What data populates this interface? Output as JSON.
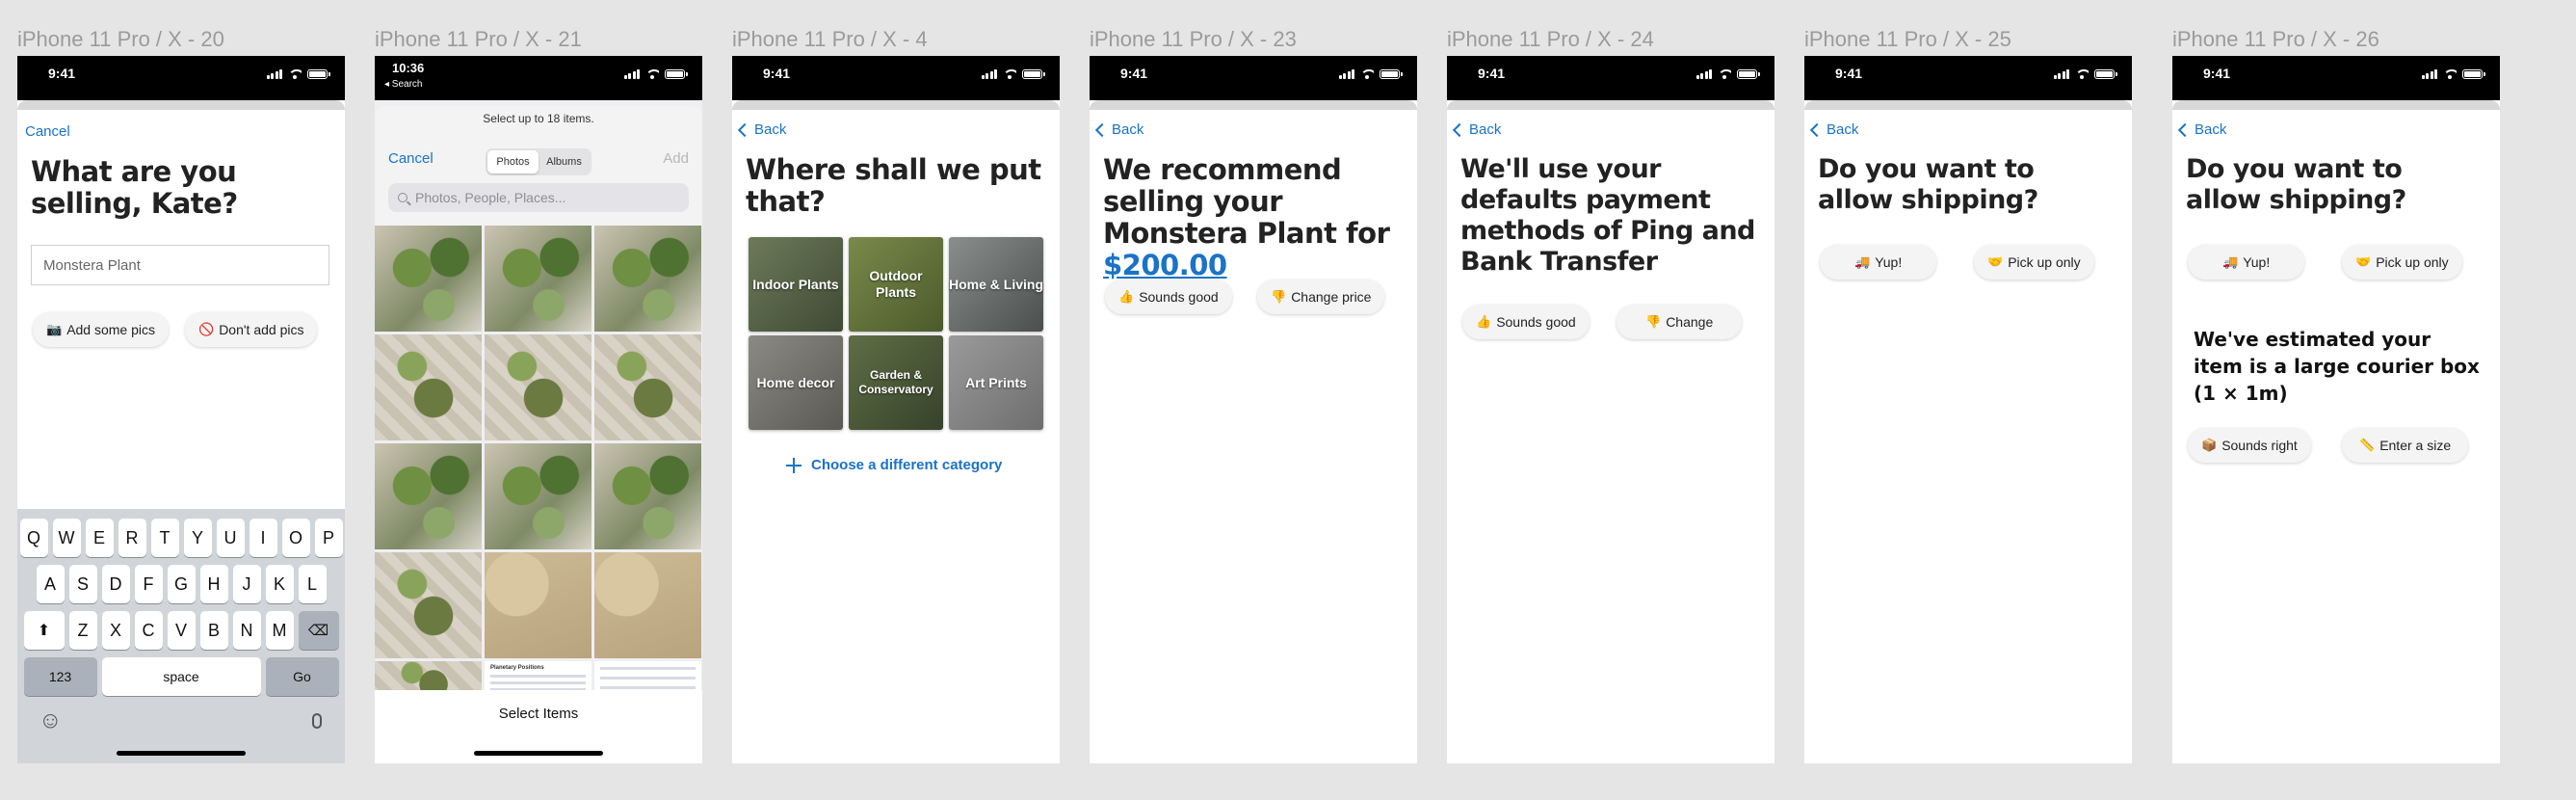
{
  "frames": [
    {
      "title": "iPhone 11 Pro / X - 20"
    },
    {
      "title": "iPhone 11 Pro / X - 21"
    },
    {
      "title": "iPhone 11 Pro / X - 4"
    },
    {
      "title": "iPhone 11 Pro / X - 23"
    },
    {
      "title": "iPhone 11 Pro / X - 24"
    },
    {
      "title": "iPhone 11 Pro / X - 25"
    },
    {
      "title": "iPhone 11 Pro / X - 26"
    }
  ],
  "status": {
    "time": "9:41",
    "time_alt": "10:36",
    "back_to_search": "◂ Search"
  },
  "screen20": {
    "cancel": "Cancel",
    "heading": "What are you selling, Kate?",
    "input_value": "Monstera Plant",
    "add_pics_emoji": "📷",
    "add_pics": "Add some pics",
    "no_pics_emoji": "🚫",
    "no_pics": "Don't add pics",
    "keyboard": {
      "row1": [
        "Q",
        "W",
        "E",
        "R",
        "T",
        "Y",
        "U",
        "I",
        "O",
        "P"
      ],
      "row2": [
        "A",
        "S",
        "D",
        "F",
        "G",
        "H",
        "J",
        "K",
        "L"
      ],
      "row3": [
        "Z",
        "X",
        "C",
        "V",
        "B",
        "N",
        "M"
      ],
      "numbers": "123",
      "space": "space",
      "go": "Go"
    }
  },
  "screen21": {
    "limit_text": "Select up to 18 items.",
    "cancel": "Cancel",
    "tab_photos": "Photos",
    "tab_albums": "Albums",
    "add": "Add",
    "search_placeholder": "Photos, People, Places...",
    "sheet_title": "Planetary Positions",
    "select_items": "Select Items"
  },
  "screen4": {
    "back": "Back",
    "heading": "Where shall we put that?",
    "categories": [
      "Indoor Plants",
      "Outdoor Plants",
      "Home & Living",
      "Home decor",
      "Garden & Conservatory",
      "Art Prints"
    ],
    "choose": "Choose a different category"
  },
  "screen23": {
    "back": "Back",
    "heading_pre": "We recommend selling your Monstera Plant for ",
    "price": "$200.00",
    "good_emoji": "👍",
    "good": "Sounds good",
    "change_emoji": "👎",
    "change": "Change price"
  },
  "screen24": {
    "back": "Back",
    "heading": "We'll use your defaults payment methods of Ping and Bank Transfer",
    "good_emoji": "👍",
    "good": "Sounds good",
    "change_emoji": "👎",
    "change": "Change"
  },
  "screen25": {
    "back": "Back",
    "heading": "Do you want to allow shipping?",
    "yes_emoji": "🚚",
    "yes": "Yup!",
    "pickup_emoji": "🤝",
    "pickup": "Pick up only"
  },
  "screen26": {
    "back": "Back",
    "heading": "Do you want to allow shipping?",
    "yes_emoji": "🚚",
    "yes": "Yup!",
    "pickup_emoji": "🤝",
    "pickup": "Pick up only",
    "estimate": "We've estimated your item is a large courier box (1 × 1m)",
    "right_emoji": "📦",
    "right": "Sounds right",
    "size_emoji": "📏",
    "size": "Enter a size"
  },
  "colors": {
    "accent": "#1a73c8",
    "canvas": "#e5e5e5"
  }
}
